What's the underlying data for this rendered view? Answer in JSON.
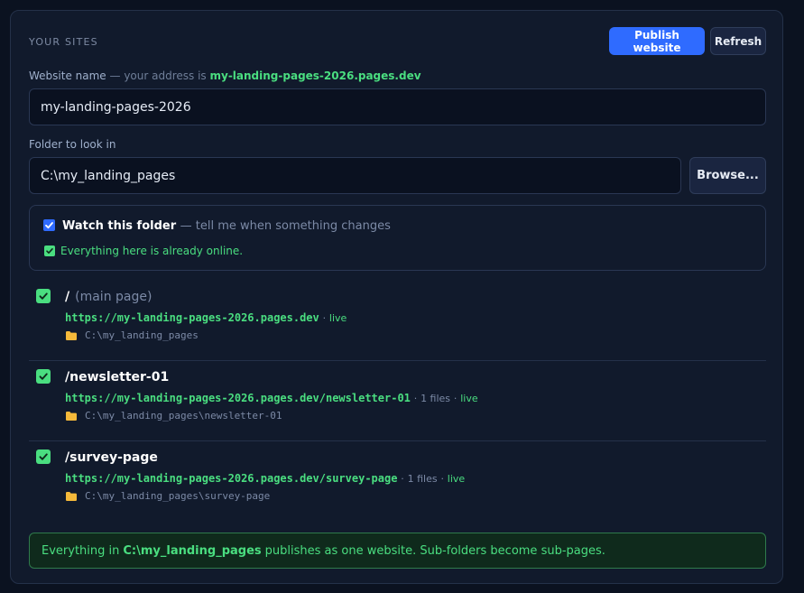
{
  "header": {
    "title": "YOUR SITES",
    "publish_label": "Publish website",
    "refresh_label": "Refresh"
  },
  "website": {
    "label": "Website name",
    "hint": "— your address is",
    "address": "my-landing-pages-2026.pages.dev",
    "value": "my-landing-pages-2026"
  },
  "folder": {
    "label": "Folder to look in",
    "value": "C:\\my_landing_pages",
    "browse_label": "Browse..."
  },
  "watch": {
    "checked": true,
    "label": "Watch this folder",
    "hint": "— tell me when something changes",
    "status": "Everything here is already online."
  },
  "routes": [
    {
      "path": "/",
      "sublabel": "(main page)",
      "url": "https://my-landing-pages-2026.pages.dev",
      "files": "",
      "status": "live",
      "folder": "C:\\my_landing_pages"
    },
    {
      "path": "/newsletter-01",
      "sublabel": "",
      "url": "https://my-landing-pages-2026.pages.dev/newsletter-01",
      "files": "1 files",
      "status": "live",
      "folder": "C:\\my_landing_pages\\newsletter-01"
    },
    {
      "path": "/survey-page",
      "sublabel": "",
      "url": "https://my-landing-pages-2026.pages.dev/survey-page",
      "files": "1 files",
      "status": "live",
      "folder": "C:\\my_landing_pages\\survey-page"
    }
  ],
  "note": {
    "prefix": "Everything in",
    "folder": "C:\\my_landing_pages",
    "suffix": "publishes as one website. Sub-folders become sub-pages."
  },
  "colors": {
    "accent": "#2f6bff",
    "success": "#4ade80",
    "panel": "#111a2c",
    "background": "#0b1220"
  },
  "icons": {
    "check": "check-icon",
    "folder": "folder-icon"
  }
}
